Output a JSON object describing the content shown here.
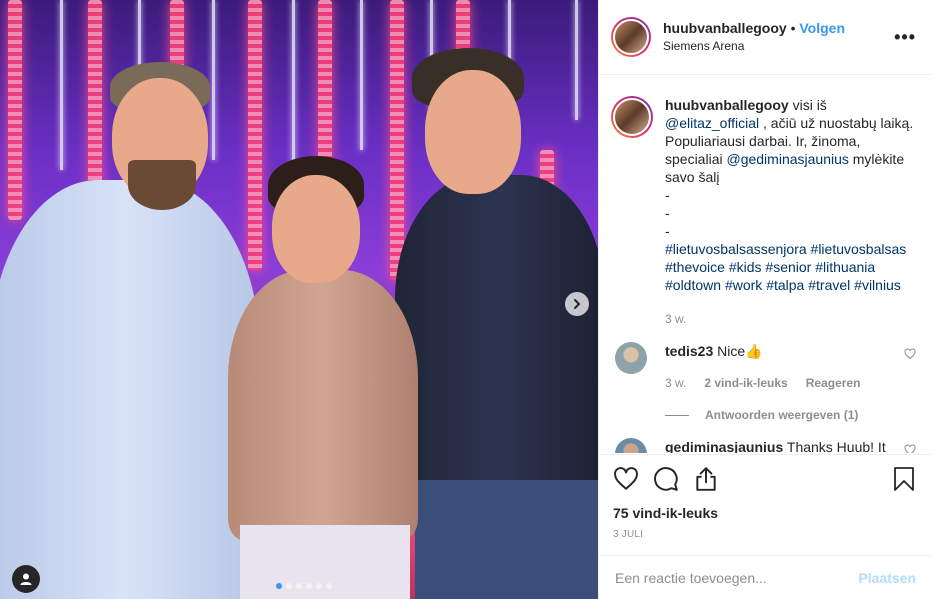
{
  "post": {
    "username": "huubvanballegooy",
    "follow_sep": " • ",
    "follow_label": "Volgen",
    "location": "Siemens Arena",
    "more_label": "•••"
  },
  "caption": {
    "username": "huubvanballegooy",
    "text_1": " visi iš ",
    "mention_1": "@elitaz_official",
    "text_2": " , ačiū už nuostabų laiką. Populiariausi darbai. Ir, žinoma, specialiai ",
    "mention_2": "@gediminasjaunius",
    "text_3": " mylėkite savo šalį",
    "dashes": [
      "-",
      "-",
      "-"
    ],
    "hashtags": [
      "#lietuvosbalsassenjora",
      "#lietuvosbalsas",
      "#thevoice",
      "#kids",
      "#senior",
      "#lithuania",
      "#oldtown",
      "#work",
      "#talpa",
      "#travel",
      "#vilnius"
    ],
    "time": "3 w."
  },
  "comments": [
    {
      "username": "tedis23",
      "text": " Nice👍",
      "time": "3 w.",
      "likes": "2 vind-ik-leuks",
      "reply": "Reageren",
      "view_replies": "Antwoorden weergeven (1)"
    },
    {
      "username": "gediminasjaunius",
      "text": " Thanks Huub! It"
    }
  ],
  "actions": {
    "likes": "75 vind-ik-leuks",
    "date": "3 JULI"
  },
  "add_comment": {
    "placeholder": "Een reactie toevoegen...",
    "post_label": "Plaatsen"
  },
  "carousel": {
    "count": 6,
    "active_index": 0
  },
  "colors": {
    "link_blue": "#3897f0",
    "hashtag": "#003569",
    "muted": "#8e8e8e",
    "post_disabled": "#b3dbff"
  }
}
